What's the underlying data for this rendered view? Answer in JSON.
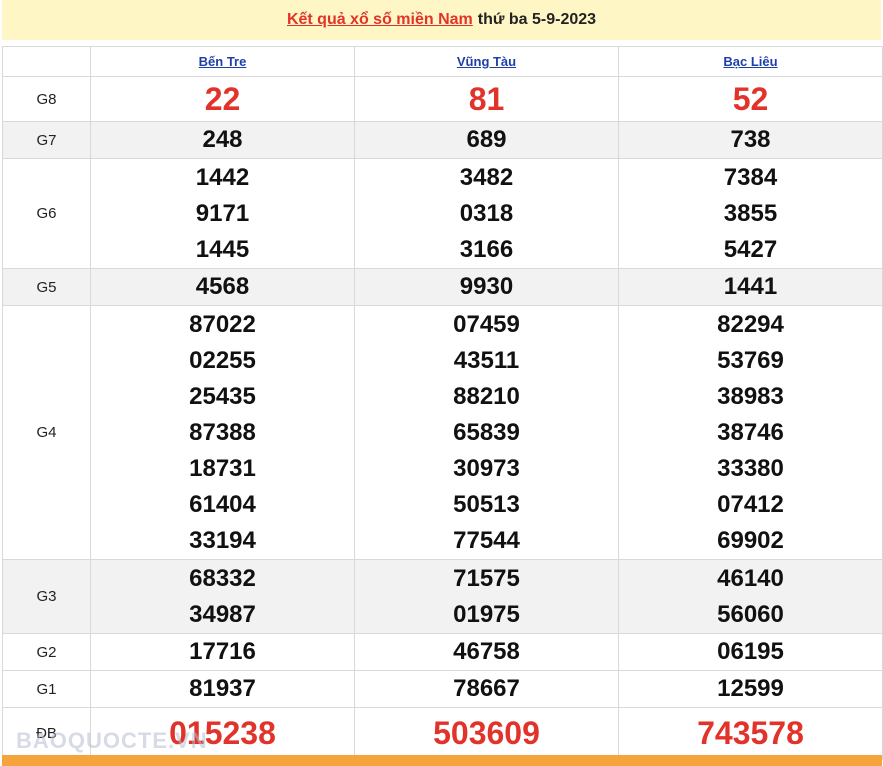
{
  "header": {
    "title_link": "Kết quả xổ số miền Nam",
    "title_date": "thứ ba 5-9-2023"
  },
  "provinces": [
    "Bến Tre",
    "Vũng Tàu",
    "Bạc Liêu"
  ],
  "prizes": [
    {
      "label": "G8",
      "values": [
        [
          "22"
        ],
        [
          "81"
        ],
        [
          "52"
        ]
      ]
    },
    {
      "label": "G7",
      "values": [
        [
          "248"
        ],
        [
          "689"
        ],
        [
          "738"
        ]
      ]
    },
    {
      "label": "G6",
      "values": [
        [
          "1442",
          "9171",
          "1445"
        ],
        [
          "3482",
          "0318",
          "3166"
        ],
        [
          "7384",
          "3855",
          "5427"
        ]
      ]
    },
    {
      "label": "G5",
      "values": [
        [
          "4568"
        ],
        [
          "9930"
        ],
        [
          "1441"
        ]
      ]
    },
    {
      "label": "G4",
      "values": [
        [
          "87022",
          "02255",
          "25435",
          "87388",
          "18731",
          "61404",
          "33194"
        ],
        [
          "07459",
          "43511",
          "88210",
          "65839",
          "30973",
          "50513",
          "77544"
        ],
        [
          "82294",
          "53769",
          "38983",
          "38746",
          "33380",
          "07412",
          "69902"
        ]
      ]
    },
    {
      "label": "G3",
      "values": [
        [
          "68332",
          "34987"
        ],
        [
          "71575",
          "01975"
        ],
        [
          "46140",
          "56060"
        ]
      ]
    },
    {
      "label": "G2",
      "values": [
        [
          "17716"
        ],
        [
          "46758"
        ],
        [
          "06195"
        ]
      ]
    },
    {
      "label": "G1",
      "values": [
        [
          "81937"
        ],
        [
          "78667"
        ],
        [
          "12599"
        ]
      ]
    },
    {
      "label": "ĐB",
      "values": [
        [
          "015238"
        ],
        [
          "503609"
        ],
        [
          "743578"
        ]
      ]
    }
  ],
  "watermark": "BAOQUOCTE.VN",
  "colors": {
    "title_bg": "#fff6c5",
    "accent_red": "#e2332a",
    "province_blue": "#1f3fa8",
    "bottom_bar": "#f5a43c"
  }
}
